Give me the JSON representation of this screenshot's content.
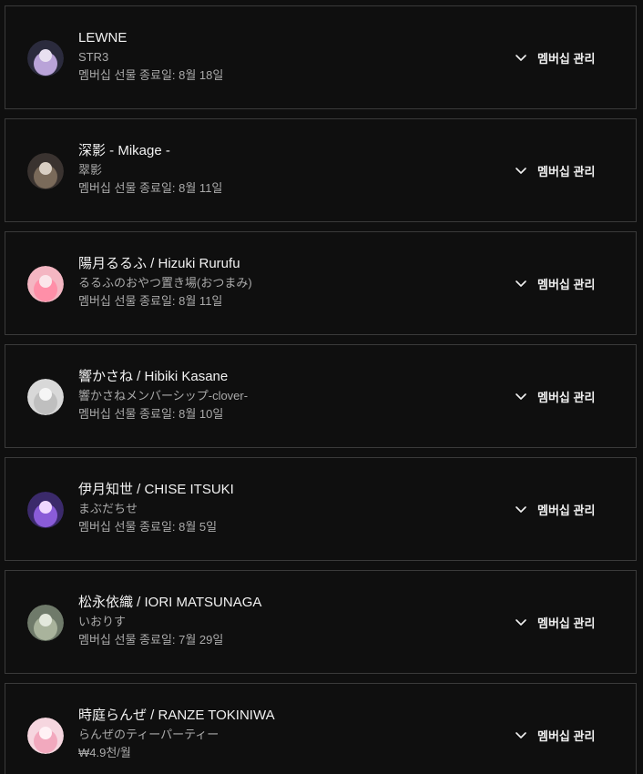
{
  "colors": {
    "background": "#0f0f0f",
    "border": "#3a3a3a",
    "primary_text": "#f1f1f1",
    "secondary_text": "#aaaaaa"
  },
  "memberships": [
    {
      "name": "LEWNE",
      "tier": "STR3",
      "detail": "멤버십 선물 종료일: 8월 18일",
      "action_label": "멤버십 관리",
      "action_icon": "chevron-down-icon",
      "avatar_colors": [
        "#2b2b3d",
        "#b9a3d8",
        "#e8e0f0"
      ]
    },
    {
      "name": "深影 - Mikage -",
      "tier": "翠影",
      "detail": "멤버십 선물 종료일: 8월 11일",
      "action_label": "멤버십 관리",
      "action_icon": "chevron-down-icon",
      "avatar_colors": [
        "#3a3330",
        "#7a6a5a",
        "#d9cfc4"
      ]
    },
    {
      "name": "陽月るるふ / Hizuki Rurufu",
      "tier": "るるふのおやつ置き場(おつまみ)",
      "detail": "멤버십 선물 종료일: 8월 11일",
      "action_label": "멤버십 관리",
      "action_icon": "chevron-down-icon",
      "avatar_colors": [
        "#f4b6c2",
        "#ff8fa8",
        "#fbe6ea"
      ]
    },
    {
      "name": "響かさね / Hibiki Kasane",
      "tier": "響かさねメンバーシップ-clover-",
      "detail": "멤버십 선물 종료일: 8월 10일",
      "action_label": "멤버십 관리",
      "action_icon": "chevron-down-icon",
      "avatar_colors": [
        "#d8d8d8",
        "#bfbfbf",
        "#f5f5f5"
      ]
    },
    {
      "name": "伊月知世 / CHISE ITSUKI",
      "tier": "まぶだちせ",
      "detail": "멤버십 선물 종료일: 8월 5일",
      "action_label": "멤버십 관리",
      "action_icon": "chevron-down-icon",
      "avatar_colors": [
        "#3b2a6b",
        "#8a5cd8",
        "#f0d8ff"
      ]
    },
    {
      "name": "松永依織 / IORI MATSUNAGA",
      "tier": "いおりす",
      "detail": "멤버십 선물 종료일: 7월 29일",
      "action_label": "멤버십 관리",
      "action_icon": "chevron-down-icon",
      "avatar_colors": [
        "#6f7a6a",
        "#a9b39c",
        "#e3e8dc"
      ]
    },
    {
      "name": "時庭らんぜ / RANZE TOKINIWA",
      "tier": "らんぜのティーパーティー",
      "detail": "₩4.9천/월",
      "action_label": "멤버십 관리",
      "action_icon": "chevron-down-icon",
      "avatar_colors": [
        "#f6d6df",
        "#f2a9be",
        "#fff1f5"
      ]
    }
  ]
}
